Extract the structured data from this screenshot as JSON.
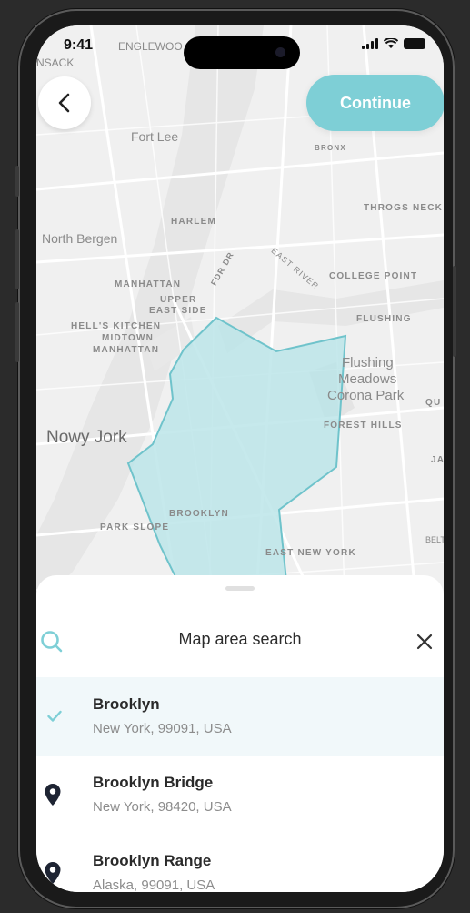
{
  "status_bar": {
    "time": "9:41"
  },
  "map": {
    "labels": {
      "englewood": "Englewoo",
      "nsack": "nsack",
      "fort_lee": "Fort Lee",
      "bronx": "BRONX",
      "throgs_neck": "THROGS NECK",
      "harlem": "HARLEM",
      "north_bergen": "North Bergen",
      "fdr_dr": "FDR Dr",
      "east_river": "East River",
      "college_point": "COLLEGE POINT",
      "manhattan": "MANHATTAN",
      "upper_east_side_1": "UPPER",
      "upper_east_side_2": "EAST SIDE",
      "flushing": "FLUSHING",
      "hells_kitchen": "HELL'S KITCHEN",
      "midtown_1": "MIDTOWN",
      "midtown_2": "MANHATTAN",
      "flushing_meadows_1": "Flushing",
      "flushing_meadows_2": "Meadows",
      "flushing_meadows_3": "Corona Park",
      "qu": "QU",
      "forest_hills": "FOREST HILLS",
      "nowy_jork": "Nowy Jork",
      "ja": "JA",
      "brooklyn": "BROOKLYN",
      "park_slope": "PARK SLOPE",
      "bel": "Belt",
      "east_new_york": "EAST NEW YORK"
    },
    "area_fill_color": "#b9e4e8",
    "area_stroke_color": "#6fc3cb"
  },
  "header": {
    "continue_label": "Continue"
  },
  "sheet": {
    "title": "Map area search",
    "results": [
      {
        "title": "Brooklyn",
        "subtitle": "New York, 99091, USA",
        "selected": true,
        "icon": "check-icon"
      },
      {
        "title": "Brooklyn Bridge",
        "subtitle": "New York, 98420, USA",
        "selected": false,
        "icon": "location-pin-icon"
      },
      {
        "title": "Brooklyn Range",
        "subtitle": "Alaska, 99091, USA",
        "selected": false,
        "icon": "location-pin-icon"
      }
    ]
  },
  "colors": {
    "accent": "#7ecfd6",
    "selected_row": "#f1f8fa"
  }
}
